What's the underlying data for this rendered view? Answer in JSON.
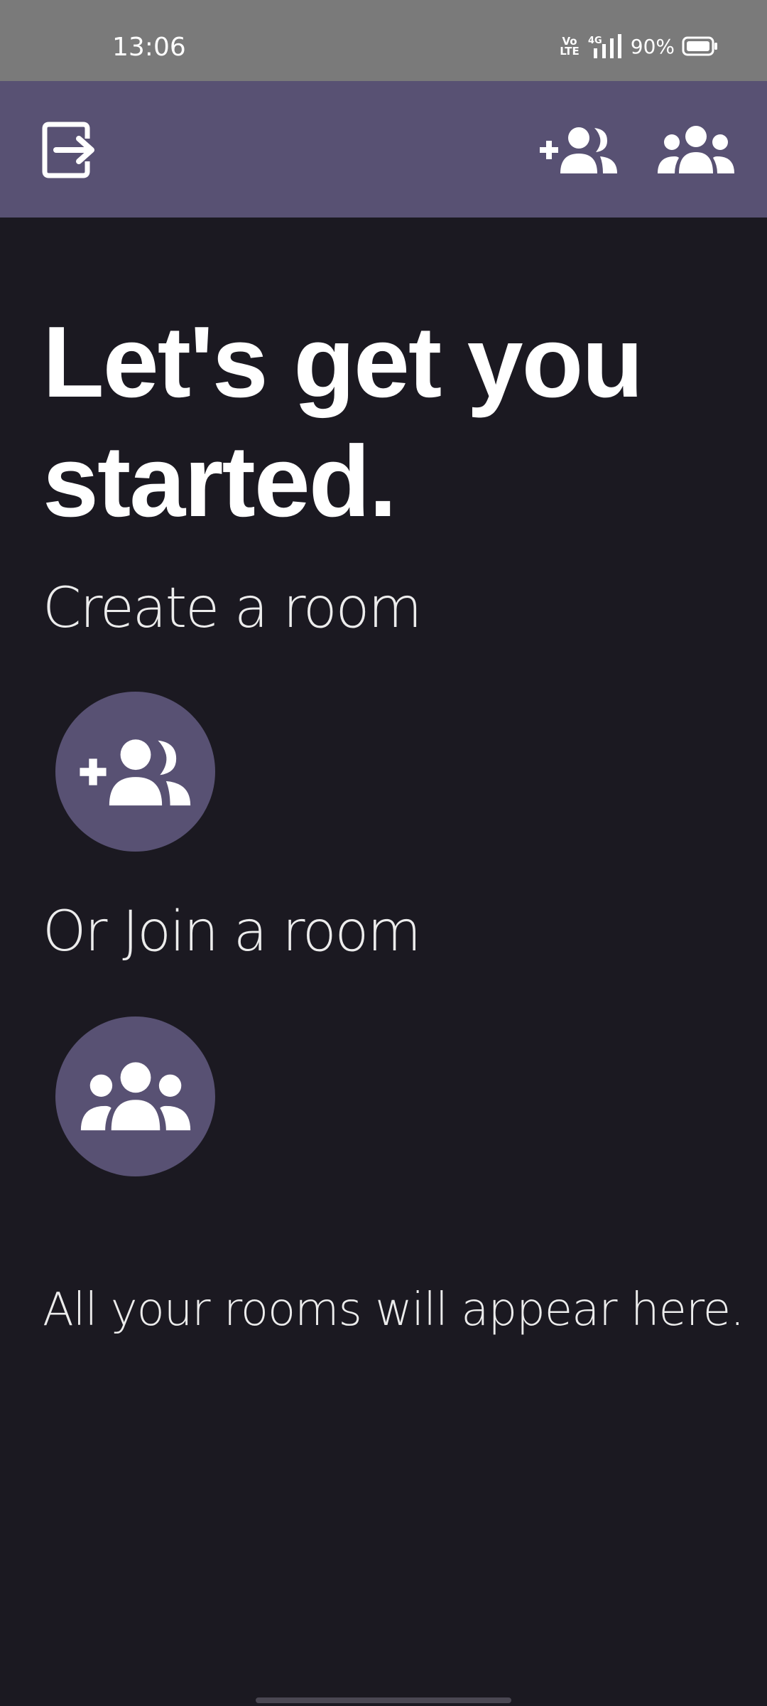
{
  "status_bar": {
    "time": "13:06",
    "volte_top": "Vo",
    "volte_bottom": "LTE",
    "network": "4G",
    "battery": "90%"
  },
  "app_bar": {
    "icons": [
      "logout-icon",
      "add-room-icon",
      "join-room-icon"
    ]
  },
  "main": {
    "headline": "Let's get you started.",
    "create_label": "Create a room",
    "join_label": "Or Join a room",
    "empty_note": "All your rooms will appear here."
  },
  "colors": {
    "background": "#1b1921",
    "accent": "#585173",
    "status_bar": "#7a7a7a",
    "text": "#ffffff"
  }
}
